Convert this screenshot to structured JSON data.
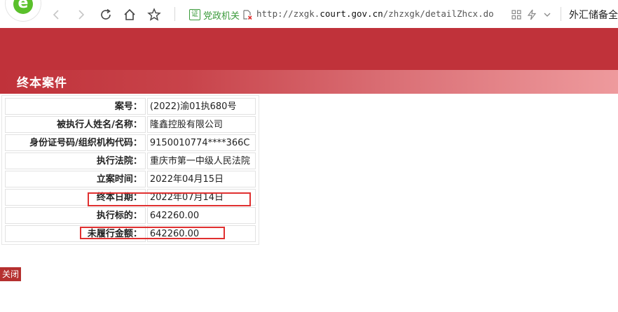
{
  "browser": {
    "cert_badge": "证",
    "cert_label": "党政机关",
    "url_scheme": "http://zxgk.",
    "url_domain": "court.gov.cn",
    "url_path": "/zhzxgk/detailZhcx.do",
    "right_text": "外汇储备全",
    "icons": [
      "back-icon",
      "forward-icon",
      "refresh-icon",
      "home-icon",
      "star-icon",
      "grid-icon",
      "lightning-icon",
      "chevron-down-icon"
    ]
  },
  "page": {
    "title": "终本案件",
    "close_label": "关闭",
    "accent_color": "#c0323a",
    "highlight_color": "#e03030"
  },
  "details": [
    {
      "label": "案号：",
      "value": "(2022)渝01执680号"
    },
    {
      "label": "被执行人姓名/名称：",
      "value": "隆鑫控股有限公司"
    },
    {
      "label": "身份证号码/组织机构代码：",
      "value": "9150010774****366C"
    },
    {
      "label": "执行法院：",
      "value": "重庆市第一中级人民法院"
    },
    {
      "label": "立案时间：",
      "value": "2022年04月15日"
    },
    {
      "label": "终本日期：",
      "value": "2022年07月14日"
    },
    {
      "label": "执行标的：",
      "value": "642260.00"
    },
    {
      "label": "未履行金额：",
      "value": "642260.00"
    }
  ]
}
